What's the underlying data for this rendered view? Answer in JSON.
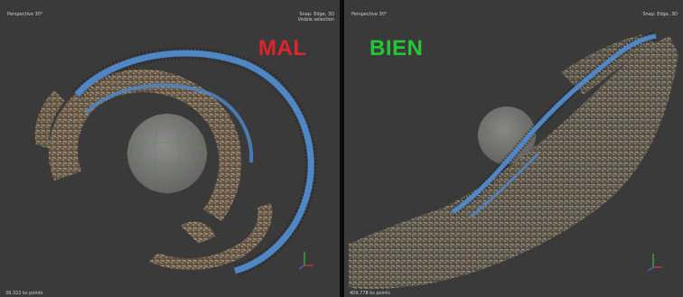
{
  "colors": {
    "viewport_bg": "#3a3a3a",
    "divider": "#0b0b0b",
    "trajectory_blue": "#4f86c6",
    "label_bad": "#e0242d",
    "label_good": "#22c934",
    "sphere": "#8a8a88"
  },
  "left_viewport": {
    "projection": "Perspective 30°",
    "snap": "Snap: Edge, 3D",
    "selection": "Visible selection",
    "point_count": "39,322 ks points",
    "label": "MAL"
  },
  "right_viewport": {
    "projection": "Perspective 30°",
    "snap": "Snap: Edge, 3D",
    "point_count": "409,778 ks points",
    "label": "BIEN"
  },
  "icons": [
    "axis-gizmo-icon",
    "navigation-sphere-icon",
    "camera-trajectory-icon",
    "point-cloud-icon"
  ]
}
